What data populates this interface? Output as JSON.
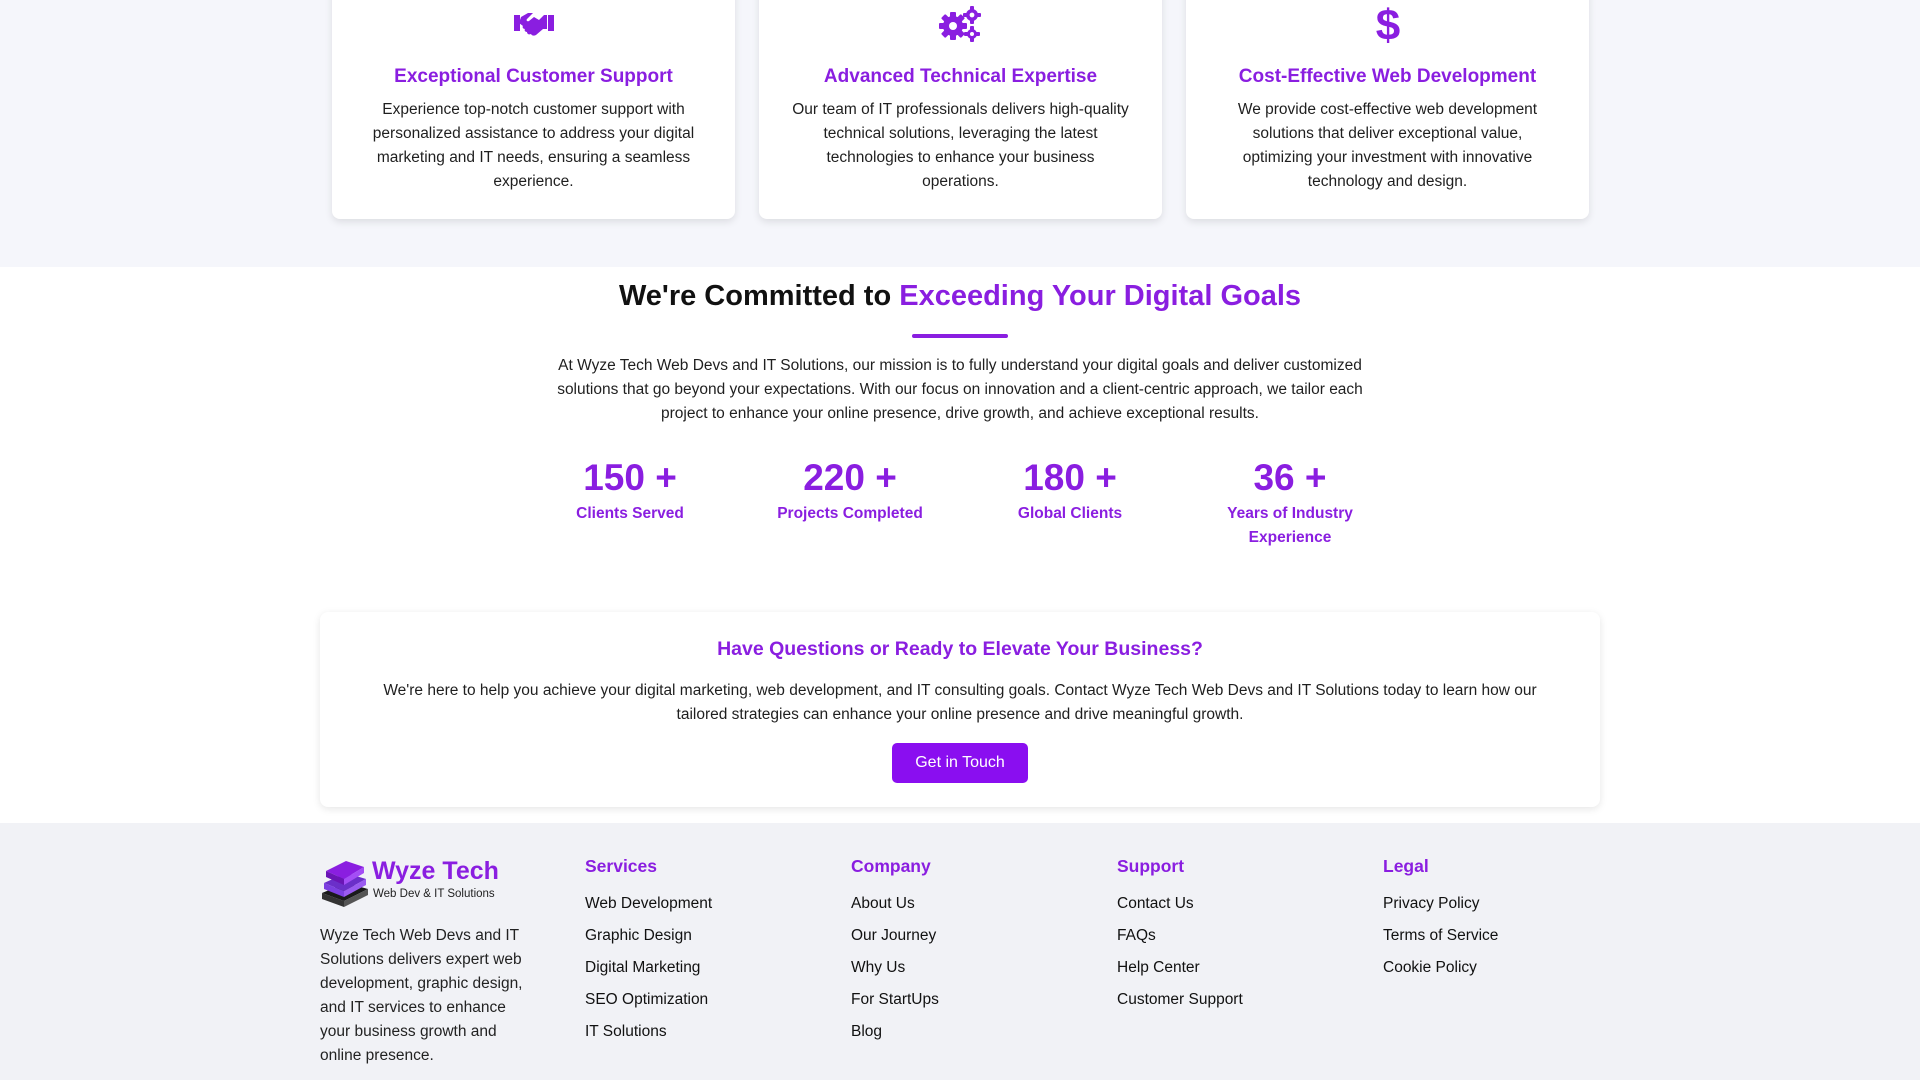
{
  "features": [
    {
      "icon": "handshake-icon",
      "title": "Exceptional Customer Support",
      "text": "Experience top-notch customer support with personalized assistance to address your digital marketing and IT needs, ensuring a seamless experience."
    },
    {
      "icon": "gears-icon",
      "title": "Advanced Technical Expertise",
      "text": "Our team of IT professionals delivers high-quality technical solutions, leveraging the latest technologies to enhance your business operations."
    },
    {
      "icon": "dollar-icon",
      "title": "Cost-Effective Web Development",
      "text": "We provide cost-effective web development solutions that deliver exceptional value, optimizing your investment with innovative technology and design."
    }
  ],
  "commitment": {
    "title_plain": "We're Committed to ",
    "title_highlight": "Exceeding Your Digital Goals",
    "text": "At Wyze Tech Web Devs and IT Solutions, our mission is to fully understand your digital goals and deliver customized solutions that go beyond your expectations. With our focus on innovation and a client-centric approach, we tailor each project to enhance your online presence, drive growth, and achieve exceptional results."
  },
  "stats": [
    {
      "value": "150 +",
      "label": "Clients Served"
    },
    {
      "value": "220 +",
      "label": "Projects Completed"
    },
    {
      "value": "180 +",
      "label": "Global Clients"
    },
    {
      "value": "36 +",
      "label": "Years of Industry Experience"
    }
  ],
  "cta": {
    "title": "Have Questions or Ready to Elevate Your Business?",
    "text": "We're here to help you achieve your digital marketing, web development, and IT consulting goals. Contact Wyze Tech Web Devs and IT Solutions today to learn how our tailored strategies can enhance your online presence and drive meaningful growth.",
    "button": "Get in Touch"
  },
  "footer": {
    "logo_name": "Wyze Tech",
    "logo_tagline": "Web Dev & IT Solutions",
    "description": "Wyze Tech Web Devs and IT Solutions delivers expert web development, graphic design, and IT services to enhance your business growth and online presence.",
    "columns": [
      {
        "heading": "Services",
        "links": [
          "Web Development",
          "Graphic Design",
          "Digital Marketing",
          "SEO Optimization",
          "IT Solutions"
        ]
      },
      {
        "heading": "Company",
        "links": [
          "About Us",
          "Our Journey",
          "Why Us",
          "For StartUps",
          "Blog"
        ]
      },
      {
        "heading": "Support",
        "links": [
          "Contact Us",
          "FAQs",
          "Help Center",
          "Customer Support"
        ]
      },
      {
        "heading": "Legal",
        "links": [
          "Privacy Policy",
          "Terms of Service",
          "Cookie Policy"
        ]
      }
    ]
  },
  "colors": {
    "accent": "#8a1ee0",
    "button": "#8a0ef0",
    "band": "#f5f6fb",
    "footer": "#f1f2f6"
  }
}
